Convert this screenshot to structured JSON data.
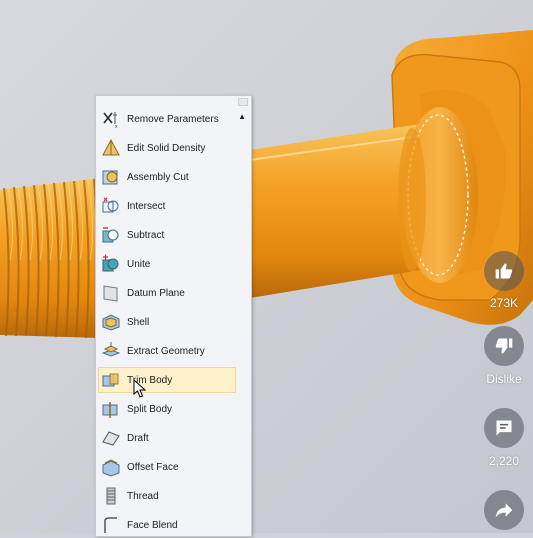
{
  "menu": {
    "items": [
      {
        "label": "Remove Parameters",
        "icon": "remove-parameters-icon"
      },
      {
        "label": "Edit Solid Density",
        "icon": "density-icon"
      },
      {
        "label": "Assembly Cut",
        "icon": "assembly-cut-icon"
      },
      {
        "label": "Intersect",
        "icon": "intersect-icon"
      },
      {
        "label": "Subtract",
        "icon": "subtract-icon"
      },
      {
        "label": "Unite",
        "icon": "unite-icon"
      },
      {
        "label": "Datum Plane",
        "icon": "datum-plane-icon"
      },
      {
        "label": "Shell",
        "icon": "shell-icon"
      },
      {
        "label": "Extract Geometry",
        "icon": "extract-geometry-icon"
      },
      {
        "label": "Trim Body",
        "icon": "trim-body-icon",
        "hovered": true
      },
      {
        "label": "Split Body",
        "icon": "split-body-icon"
      },
      {
        "label": "Draft",
        "icon": "draft-icon"
      },
      {
        "label": "Offset Face",
        "icon": "offset-face-icon"
      },
      {
        "label": "Thread",
        "icon": "thread-icon"
      },
      {
        "label": "Face Blend",
        "icon": "face-blend-icon"
      }
    ]
  },
  "rail": {
    "like_count": "273K",
    "dislike_label": "Dislike",
    "comment_count": "2,220"
  },
  "colors": {
    "part_orange": "#f39a1a",
    "background": "#cfd2d8",
    "menu_bg": "#f3f4f7",
    "hover_bg": "#fdf1cc"
  }
}
